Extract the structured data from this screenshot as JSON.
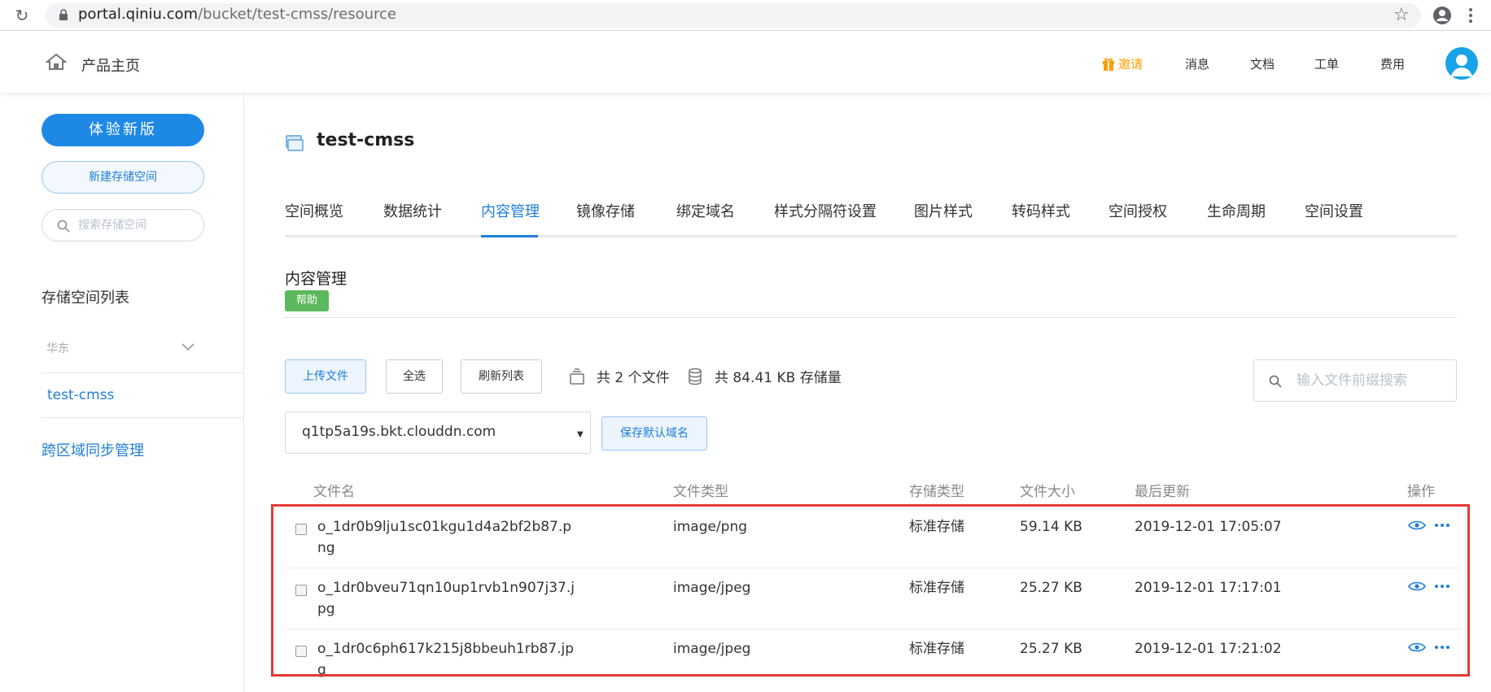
{
  "browser": {
    "url_domain": "portal.qiniu.com",
    "url_path": "/bucket/test-cmss/resource"
  },
  "header": {
    "home_label": "产品主页",
    "invite_label": "邀请",
    "nav": [
      "消息",
      "文档",
      "工单",
      "费用"
    ]
  },
  "sidebar": {
    "new_version_label": "体验新版",
    "new_bucket_label": "新建存储空间",
    "search_placeholder": "搜索存储空间",
    "bucket_list_title": "存储空间列表",
    "region_label": "华东",
    "bucket_item": "test-cmss",
    "cross_region_label": "跨区域同步管理"
  },
  "main": {
    "bucket_title": "test-cmss",
    "tabs": [
      {
        "label": "空间概览"
      },
      {
        "label": "数据统计"
      },
      {
        "label": "内容管理",
        "active": true
      },
      {
        "label": "镜像存储"
      },
      {
        "label": "绑定域名"
      },
      {
        "label": "样式分隔符设置"
      },
      {
        "label": "图片样式"
      },
      {
        "label": "转码样式"
      },
      {
        "label": "空间授权"
      },
      {
        "label": "生命周期"
      },
      {
        "label": "空间设置"
      }
    ],
    "section_title": "内容管理",
    "help_label": "帮助",
    "toolbar": {
      "upload_label": "上传文件",
      "select_all_label": "全选",
      "refresh_label": "刷新列表",
      "file_count_text": "共 2 个文件",
      "storage_text": "共 84.41 KB 存储量",
      "search_placeholder": "输入文件前缀搜索"
    },
    "domain": {
      "selected": "q1tp5a19s.bkt.clouddn.com",
      "save_label": "保存默认域名"
    },
    "table": {
      "columns": [
        "文件名",
        "文件类型",
        "存储类型",
        "文件大小",
        "最后更新",
        "操作"
      ],
      "rows": [
        {
          "name": "o_1dr0b9lju1sc01kgu1d4a2bf2b87.png",
          "type": "image/png",
          "storage": "标准存储",
          "size": "59.14 KB",
          "updated": "2019-12-01 17:05:07"
        },
        {
          "name": "o_1dr0bveu71qn10up1rvb1n907j37.jpg",
          "type": "image/jpeg",
          "storage": "标准存储",
          "size": "25.27 KB",
          "updated": "2019-12-01 17:17:01"
        },
        {
          "name": "o_1dr0c6ph617k215j8bbeuh1rb87.jpg",
          "type": "image/jpeg",
          "storage": "标准存储",
          "size": "25.27 KB",
          "updated": "2019-12-01 17:21:02"
        }
      ]
    }
  },
  "colors": {
    "accent": "#1e7ed8",
    "primary_button": "#1e88e5",
    "help_badge": "#5cb85c",
    "invite": "#ff9d00",
    "highlight": "#e53935"
  }
}
